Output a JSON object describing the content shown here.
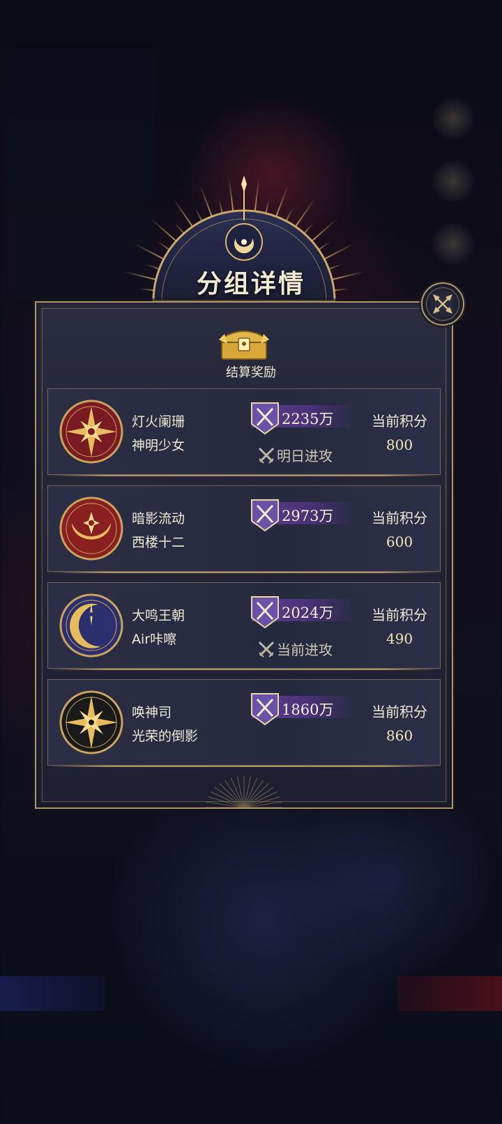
{
  "dialog": {
    "title": "分组详情",
    "reward_label": "结算奖励"
  },
  "groups": [
    {
      "guild": "灯火阑珊",
      "leader": "神明少女",
      "power": "2235万",
      "attack_status": "明日进攻",
      "score_label": "当前积分",
      "score": "800",
      "emblem": "red-compass-star-icon"
    },
    {
      "guild": "暗影流动",
      "leader": "西楼十二",
      "power": "2973万",
      "attack_status": "",
      "score_label": "当前积分",
      "score": "600",
      "emblem": "red-crescent-star-icon"
    },
    {
      "guild": "大鸣王朝",
      "leader": "Air咔嚓",
      "power": "2024万",
      "attack_status": "当前进攻",
      "score_label": "当前积分",
      "score": "490",
      "emblem": "blue-crescent-moon-icon"
    },
    {
      "guild": "唤神司",
      "leader": "光荣的倒影",
      "power": "1860万",
      "attack_status": "",
      "score_label": "当前积分",
      "score": "860",
      "emblem": "black-compass-star-icon"
    }
  ],
  "colors": {
    "gold": "#b09566",
    "panel": "#242638",
    "power_banner": "#5b3e8c",
    "emblem_red": "#7a1b24",
    "emblem_blue": "#2c2f6e",
    "emblem_black": "#1a1a1c"
  }
}
